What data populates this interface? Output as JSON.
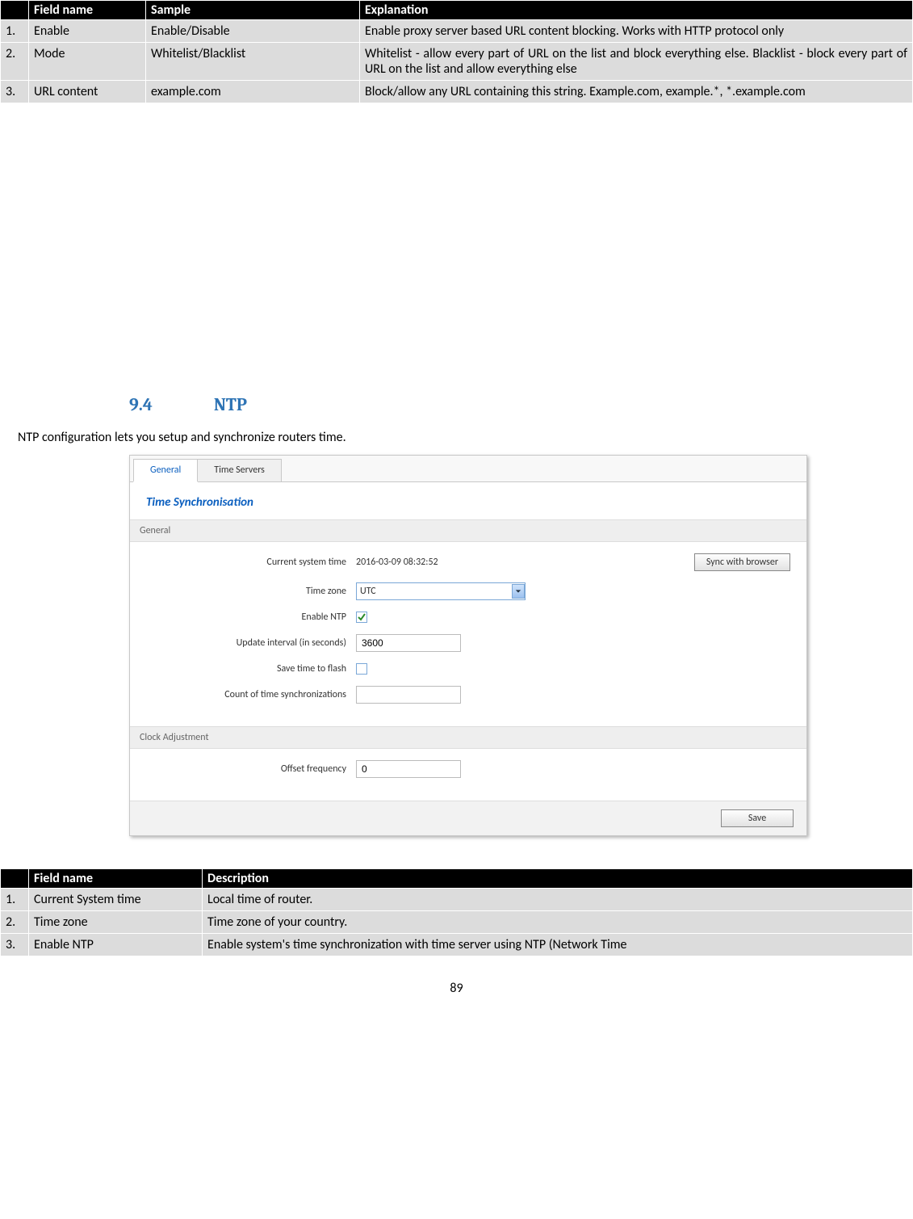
{
  "table1": {
    "headers": [
      "",
      "Field name",
      "Sample",
      "Explanation"
    ],
    "rows": [
      {
        "num": "1.",
        "name": "Enable",
        "sample": "Enable/Disable",
        "expl": "Enable proxy server based URL content blocking. Works with HTTP protocol only"
      },
      {
        "num": "2.",
        "name": "Mode",
        "sample": "Whitelist/Blacklist",
        "expl": "Whitelist - allow every part of URL on the list and block everything else. Blacklist - block every part of URL on the list and allow everything else"
      },
      {
        "num": "3.",
        "name": "URL content",
        "sample": "example.com",
        "expl": "Block/allow any URL containing this string. Example.com, example.*, *.example.com"
      }
    ]
  },
  "section": {
    "num": "9.4",
    "title": "NTP"
  },
  "intro": "NTP configuration lets you setup and synchronize routers time.",
  "panel": {
    "tabs": [
      "General",
      "Time Servers"
    ],
    "active_tab": 0,
    "title": "Time Synchronisation",
    "group_general": "General",
    "group_clock": "Clock Adjustment",
    "fields": {
      "current_system_time_label": "Current system time",
      "current_system_time_value": "2016-03-09 08:32:52",
      "sync_button": "Sync with browser",
      "time_zone_label": "Time zone",
      "time_zone_value": "UTC",
      "enable_ntp_label": "Enable NTP",
      "enable_ntp_checked": true,
      "update_interval_label": "Update interval (in seconds)",
      "update_interval_value": "3600",
      "save_time_label": "Save time to flash",
      "save_time_checked": false,
      "count_sync_label": "Count of time synchronizations",
      "count_sync_value": "",
      "offset_freq_label": "Offset frequency",
      "offset_freq_value": "0"
    },
    "save_button": "Save"
  },
  "table2": {
    "headers": [
      "",
      "Field name",
      "Description"
    ],
    "rows": [
      {
        "num": "1.",
        "name": "Current System time",
        "desc": "Local time of router."
      },
      {
        "num": "2.",
        "name": "Time zone",
        "desc": "Time zone of your country."
      },
      {
        "num": "3.",
        "name": "Enable NTP",
        "desc": "Enable system's time synchronization with time server using NTP (Network Time"
      }
    ]
  },
  "page_number": "89"
}
